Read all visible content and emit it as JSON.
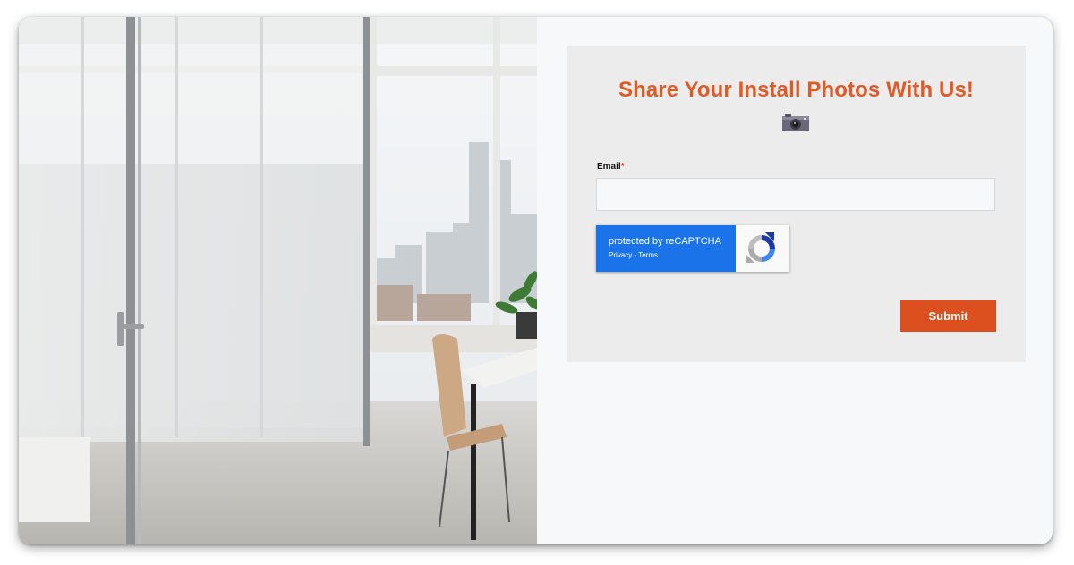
{
  "form": {
    "title": "Share Your Install Photos With Us!",
    "title_emoji_icon": "camera-icon",
    "email_label": "Email",
    "required_marker": "*",
    "email_value": "",
    "submit_label": "Submit"
  },
  "recaptcha": {
    "protected_text": "protected by reCAPTCHA",
    "privacy_link": "Privacy",
    "separator": " - ",
    "terms_link": "Terms"
  },
  "colors": {
    "accent": "#e05a26",
    "button": "#dc4f1e",
    "recaptcha_blue": "#1a73e8",
    "panel_bg": "#ececec"
  }
}
